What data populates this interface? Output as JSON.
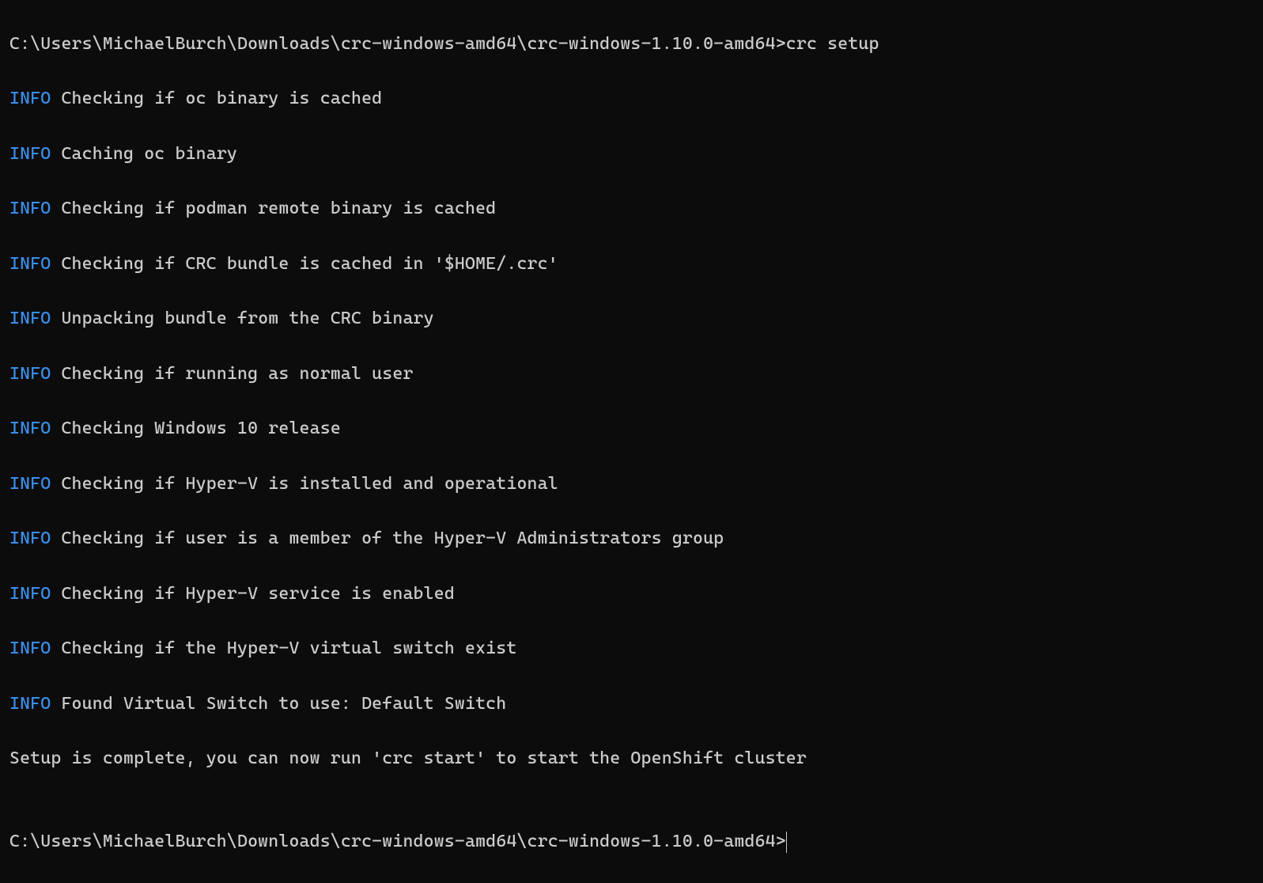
{
  "terminal": {
    "prompt_path": "C:\\Users\\MichaelBurch\\Downloads\\crc-windows-amd64\\crc-windows-1.10.0-amd64>",
    "command": "crc setup",
    "info_label": "INFO",
    "lines": [
      "Checking if oc binary is cached",
      "Caching oc binary",
      "Checking if podman remote binary is cached",
      "Checking if CRC bundle is cached in '$HOME/.crc'",
      "Unpacking bundle from the CRC binary",
      "Checking if running as normal user",
      "Checking Windows 10 release",
      "Checking if Hyper-V is installed and operational",
      "Checking if user is a member of the Hyper-V Administrators group",
      "Checking if Hyper-V service is enabled",
      "Checking if the Hyper-V virtual switch exist",
      "Found Virtual Switch to use: Default Switch"
    ],
    "completion_message": "Setup is complete, you can now run 'crc start' to start the OpenShift cluster",
    "blank_line": "",
    "final_prompt": "C:\\Users\\MichaelBurch\\Downloads\\crc-windows-amd64\\crc-windows-1.10.0-amd64>"
  }
}
